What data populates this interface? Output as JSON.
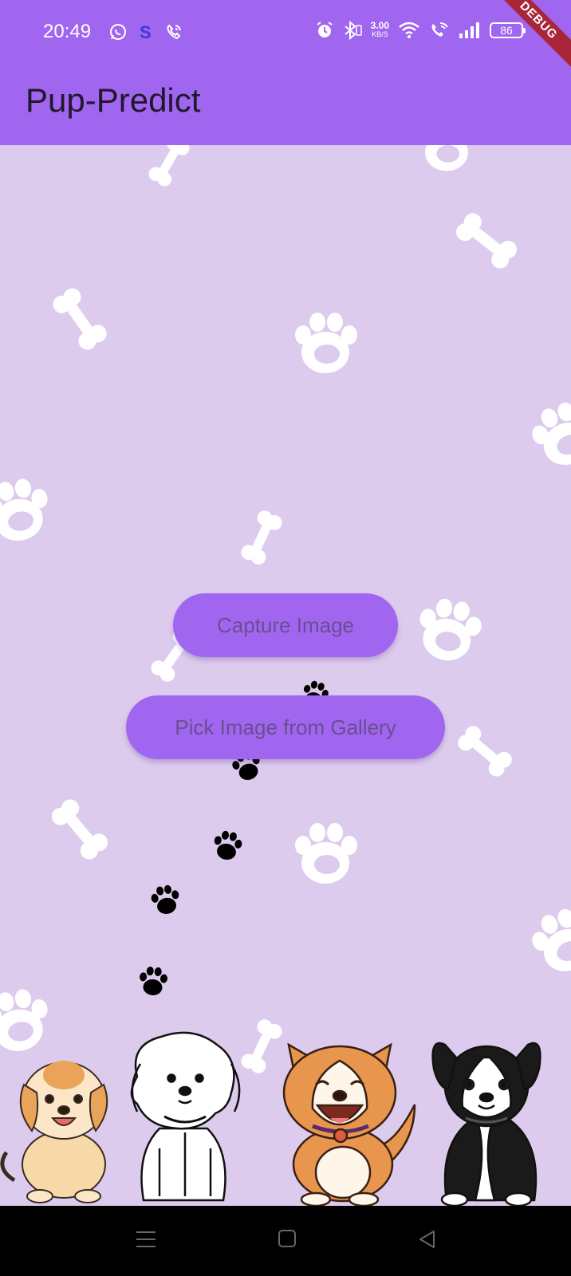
{
  "status_bar": {
    "time": "20:49",
    "left_icons": [
      "whatsapp-icon",
      "s-app-icon",
      "viber-icon"
    ],
    "net_speed_value": "3.00",
    "net_speed_unit": "KB/S",
    "battery_level": "86",
    "right_icons": [
      "alarm-icon",
      "bluetooth-icon",
      "wifi-icon",
      "wifi-call-icon",
      "signal-icon",
      "battery-icon"
    ]
  },
  "debug_banner": {
    "label": "DEBUG"
  },
  "app_bar": {
    "title": "Pup-Predict"
  },
  "actions": {
    "capture_label": "Capture Image",
    "gallery_label": "Pick Image from Gallery"
  },
  "colors": {
    "accent": "#a066ef",
    "background": "#dccbed",
    "button_text": "#6a4e91",
    "debug_banner": "#a8253a"
  },
  "navigation": {
    "items": [
      "menu-icon",
      "home-icon",
      "back-icon"
    ]
  }
}
